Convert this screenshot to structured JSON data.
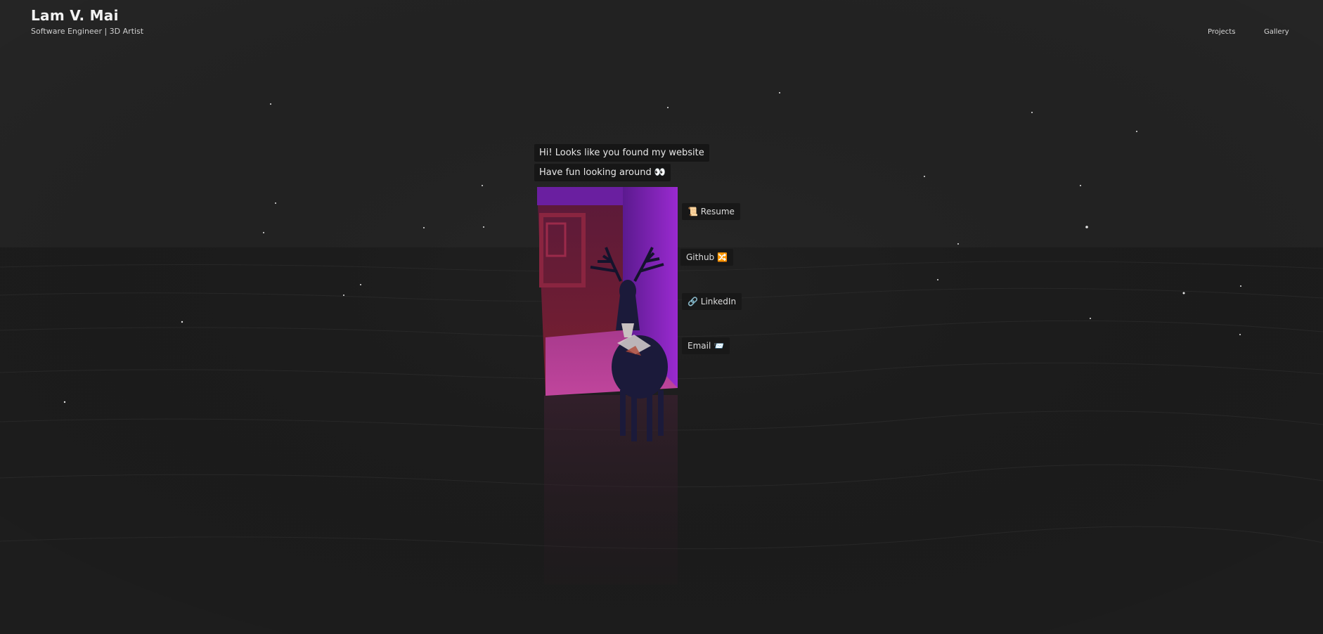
{
  "header": {
    "title": "Lam V. Mai",
    "subtitle": "Software Engineer | 3D Artist"
  },
  "nav": {
    "projects": "Projects",
    "gallery": "Gallery"
  },
  "greeting": {
    "line1": "Hi! Looks like you found my website",
    "line2": "Have fun looking around 👀"
  },
  "links": {
    "resume": {
      "icon": "📜",
      "label": "Resume"
    },
    "github": {
      "icon": "🔀",
      "label": "Github"
    },
    "linkedin": {
      "icon": "🔗",
      "label": "LinkedIn"
    },
    "email": {
      "icon": "📨",
      "label": "Email"
    }
  },
  "colors": {
    "background": "#232323",
    "portal_purple": "#7a1fa8",
    "portal_red": "#7a1e2e",
    "portal_pink": "#b23a8c",
    "deer_body": "#1b1a3a"
  }
}
